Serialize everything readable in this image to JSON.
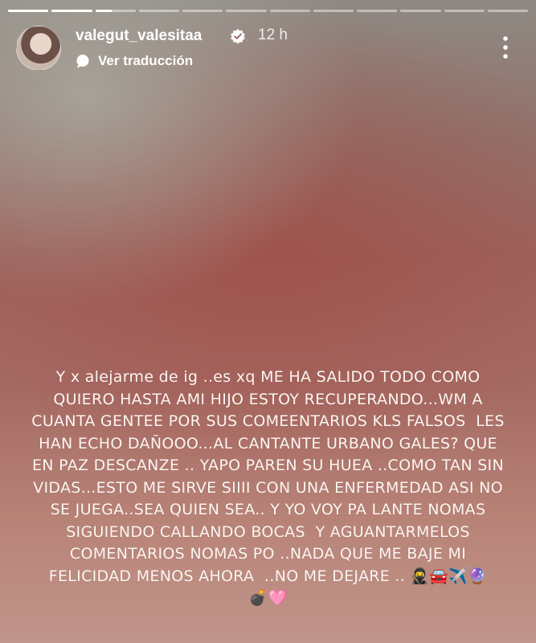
{
  "story": {
    "segments": [
      1,
      1,
      0.4,
      0,
      0,
      0,
      0,
      0,
      0,
      0,
      0,
      0
    ],
    "username": "valegut_valesitaa",
    "time": "12 h",
    "translate_label": "Ver traducción",
    "caption": "Y x alejarme de ig ..es xq ME HA SALIDO TODO COMO\nQUIERO HASTA AMI HIJO ESTOY RECUPERANDO...WM A\nCUANTA GENTEE POR SUS COMEENTARIOS KLS FALSOS  LES\nHAN ECHO DAÑOOO...AL CANTANTE URBANO GALES? QUE\nEN PAZ DESCANZE .. YAPO PAREN SU HUEA ..COMO TAN SIN\nVIDAS...ESTO ME SIRVE SIIII CON UNA ENFERMEDAD ASI NO\nSE JUEGA..SEA QUIEN SEA.. Y YO VOY PA LANTE NOMAS\nSIGUIENDO CALLANDO BOCAS  Y AGUANTARMELOS\nCOMENTARIOS NOMAS PO ..NADA QUE ME BAJE MI\nFELICIDAD MENOS AHORA  ..NO ME DEJARE .. 🥷🚘✈️🔮\n💣🩷"
  },
  "icons": {
    "verified": "verified-badge-icon",
    "translate": "translate-bubble-icon",
    "more": "more-options-icon"
  }
}
